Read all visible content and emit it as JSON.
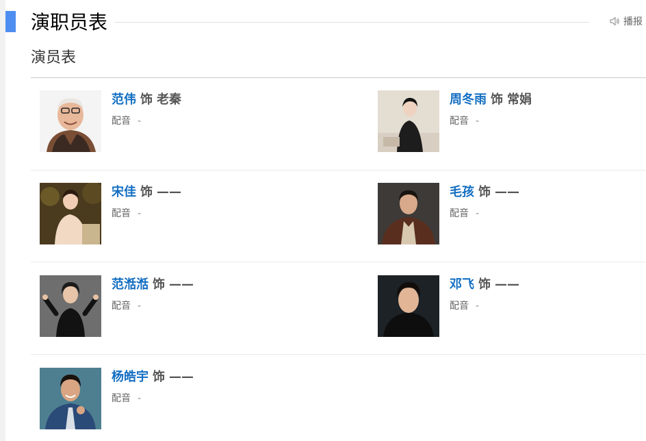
{
  "section": {
    "title": "演职员表",
    "play_label": "播报",
    "subtitle": "演员表"
  },
  "cast": [
    {
      "actor": "范伟",
      "as": "饰",
      "role": "老秦",
      "voice_label": "配音",
      "voice_value": "-"
    },
    {
      "actor": "周冬雨",
      "as": "饰",
      "role": "常娟",
      "voice_label": "配音",
      "voice_value": "-"
    },
    {
      "actor": "宋佳",
      "as": "饰",
      "role": "——",
      "voice_label": "配音",
      "voice_value": "-"
    },
    {
      "actor": "毛孩",
      "as": "饰",
      "role": "——",
      "voice_label": "配音",
      "voice_value": "-"
    },
    {
      "actor": "范湉湉",
      "as": "饰",
      "role": "——",
      "voice_label": "配音",
      "voice_value": "-"
    },
    {
      "actor": "邓飞",
      "as": "饰",
      "role": "——",
      "voice_label": "配音",
      "voice_value": "-"
    },
    {
      "actor": "杨皓宇",
      "as": "饰",
      "role": "——",
      "voice_label": "配音",
      "voice_value": "-"
    }
  ],
  "colors": {
    "accent": "#4e8ef0",
    "actor_link": "#136ec2"
  }
}
